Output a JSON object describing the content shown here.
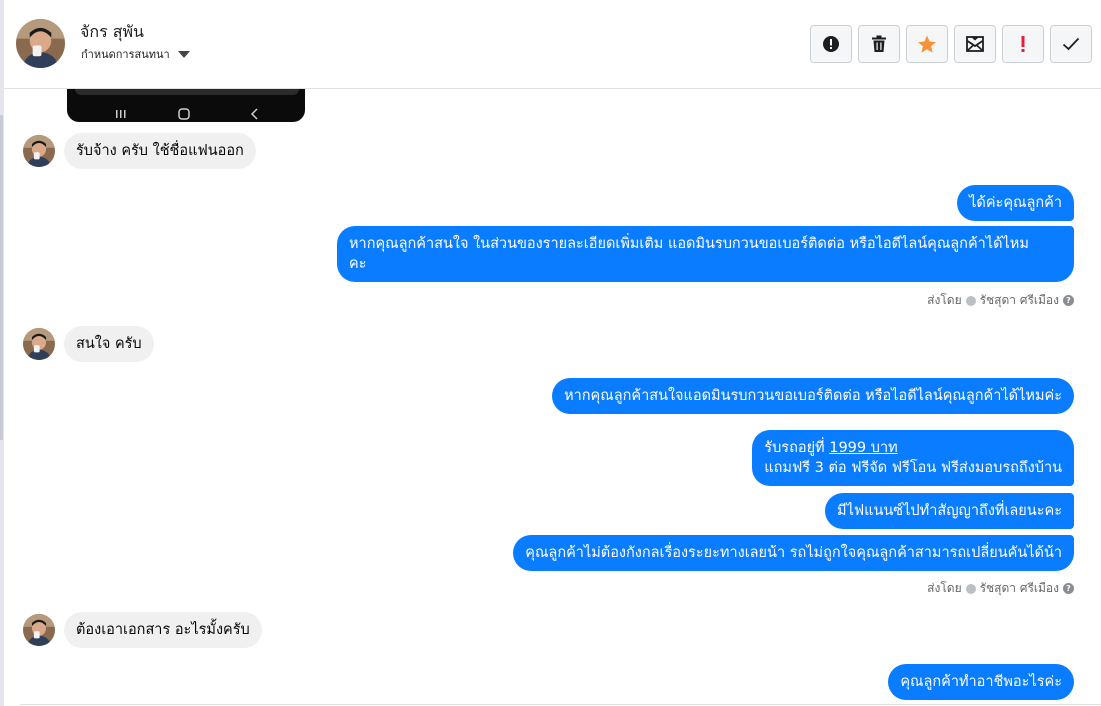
{
  "header": {
    "contact_name": "จักร สุพัน",
    "assign_label": "กำหนดการสนทนา",
    "toolbar": [
      {
        "name": "alert-button",
        "icon": "alert-circle-icon"
      },
      {
        "name": "delete-button",
        "icon": "trash-icon"
      },
      {
        "name": "star-button",
        "icon": "star-icon"
      },
      {
        "name": "mark-unread-button",
        "icon": "envelope-icon"
      },
      {
        "name": "priority-button",
        "icon": "exclamation-icon"
      },
      {
        "name": "done-button",
        "icon": "check-icon"
      }
    ]
  },
  "colors": {
    "outgoing_bubble": "#0a7cff",
    "incoming_bubble": "#f0f0f0",
    "star": "#f7923b",
    "priority": "#e41e3f"
  },
  "messages": {
    "in1": "รับจ้าง ครับ ใช้ชื่อแฟนออก",
    "out1": "ได้ค่ะคุณลูกค้า",
    "out2_line1": "หากคุณลูกค้าสนใจ ในส่วนของรายละเอียดเพิ่มเติม แอดมินรบกวนขอเบอร์ติดต่อ หรือไอดีไลน์คุณลูกค้าได้ไหม",
    "out2_line2": "คะ",
    "in2": "สนใจ ครับ",
    "out3": "หากคุณลูกค้าสนใจแอดมินรบกวนขอเบอร์ติดต่อ หรือไอดีไลน์คุณลูกค้าได้ไหมค่ะ",
    "out4_prefix": "รับรถอยู่ที่ ",
    "out4_link": "1999 บาท",
    "out4_line2": "แถมฟรี 3 ต่อ ฟรีจัด ฟรีโอน  ฟรีส่งมอบรถถึงบ้าน",
    "out5": "มีไฟแนนซ์ไปทำสัญญาถึงที่เลยนะคะ",
    "out6": "คุณลูกค้าไม่ต้องกังกลเรื่องระยะทางเลยน้า  รถไม่ถูกใจคุณลูกค้าสามารถเปลี่ยนคันได้น้า",
    "in3": "ต้องเอาเอกสาร อะไรมั้งครับ",
    "out7": "คุณลูกค้าทำอาชีพอะไรค่ะ"
  },
  "sent_by": {
    "prefix": "ส่งโดย",
    "agent_name": "รัชสุดา ศรีเมือง"
  }
}
